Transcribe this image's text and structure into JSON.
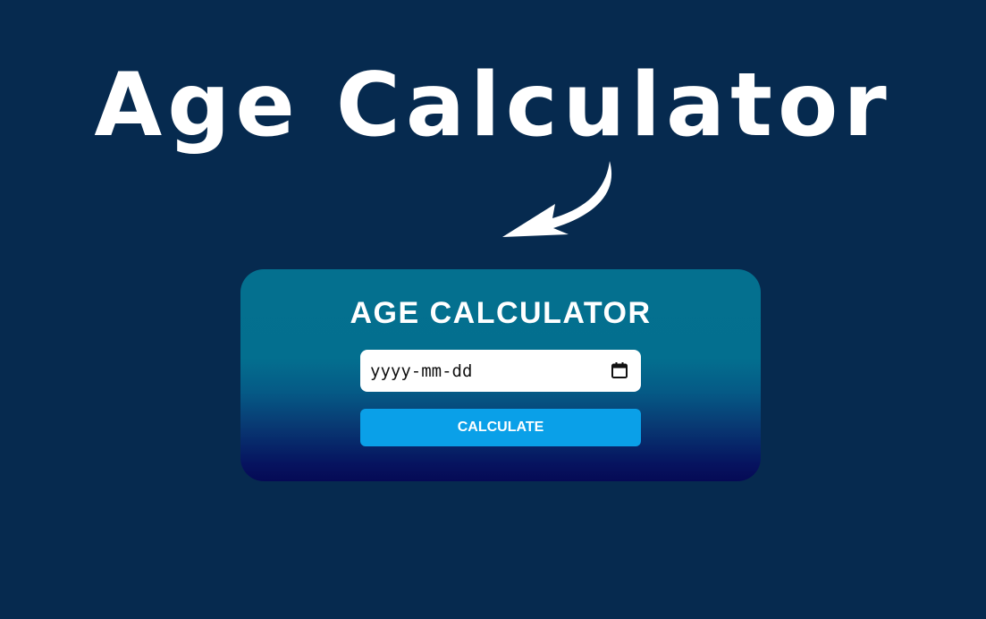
{
  "hero": {
    "title": "Age Calculator"
  },
  "icons": {
    "arrow": "curved-arrow-icon",
    "calendar": "calendar-icon"
  },
  "card": {
    "title": "AGE CALCULATOR",
    "date_input": {
      "placeholder": "yyyy-mm-dd",
      "value": ""
    },
    "calculate_label": "CALCULATE"
  },
  "colors": {
    "page_background": "#062a4f",
    "card_gradient_top": "#04708f",
    "card_gradient_bottom": "#050a55",
    "button": "#0aa0e8",
    "text": "#ffffff"
  }
}
